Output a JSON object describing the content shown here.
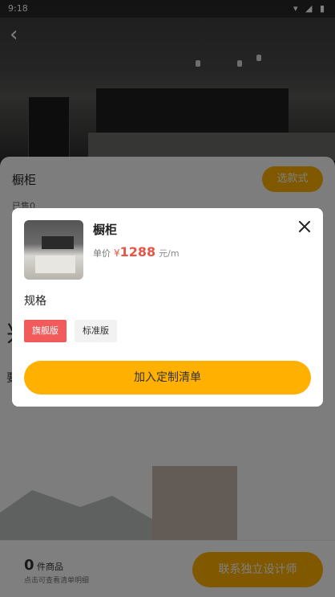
{
  "status_bar": {
    "time": "9:18",
    "icons": "▾ ◢ ▮"
  },
  "page": {
    "title": "橱柜",
    "sold": "已售0",
    "style_button": "选款式",
    "big_char": "兴",
    "side_char": "要"
  },
  "bottom_bar": {
    "count": "0",
    "count_unit": "件商品",
    "hint": "点击可查看清单明细",
    "contact_button": "联系独立设计师"
  },
  "modal": {
    "product_name": "橱柜",
    "price_label": "单价",
    "currency": "¥",
    "price": "1288",
    "unit": "元/m",
    "spec_label": "规格",
    "options": [
      "旗舰版",
      "标准版"
    ],
    "selected_option": "旗舰版",
    "add_button": "加入定制清单"
  },
  "colors": {
    "accent": "#ffb000",
    "price": "#e85446",
    "selected": "#f25b5b"
  }
}
